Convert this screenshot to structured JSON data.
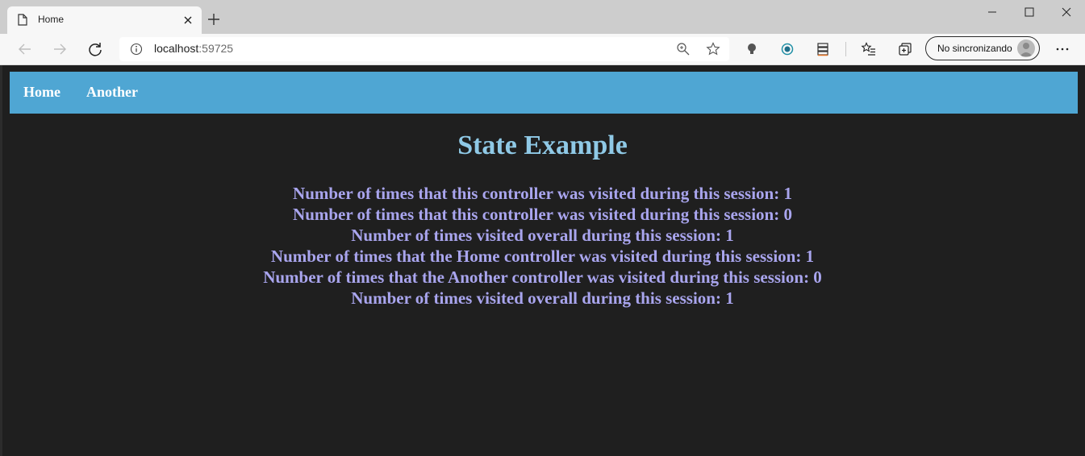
{
  "tab": {
    "title": "Home"
  },
  "address_bar": {
    "host": "localhost",
    "port": ":59725"
  },
  "profile": {
    "label": "No sincronizando"
  },
  "navbar": {
    "links": [
      {
        "label": "Home"
      },
      {
        "label": "Another"
      }
    ],
    "color": "#4fa6d3"
  },
  "main": {
    "heading": "State Example",
    "lines": [
      "Number of times that this controller was visited during this session: 1",
      "Number of times that this controller was visited during this session: 0",
      "Number of times visited overall during this session: 1",
      "Number of times that the Home controller was visited during this session: 1",
      "Number of times that the Another controller was visited during this session: 0",
      "Number of times visited overall during this session: 1"
    ]
  },
  "colors": {
    "page_background": "#1f1f1f",
    "heading": "#8fc9e6",
    "body_text": "#a9a5ee"
  }
}
